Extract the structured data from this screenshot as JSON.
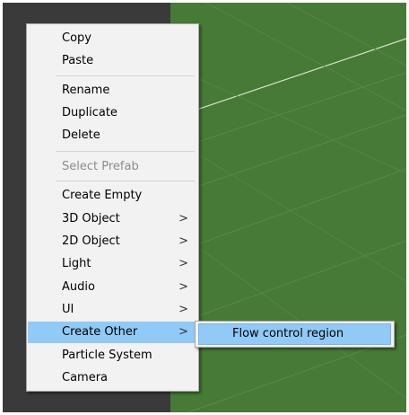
{
  "context_menu": {
    "items": [
      {
        "label": "Copy"
      },
      {
        "label": "Paste"
      },
      {
        "label": "Rename"
      },
      {
        "label": "Duplicate"
      },
      {
        "label": "Delete"
      },
      {
        "label": "Select Prefab",
        "disabled": true
      },
      {
        "label": "Create Empty"
      },
      {
        "label": "3D Object",
        "arrow": ">"
      },
      {
        "label": "2D Object",
        "arrow": ">"
      },
      {
        "label": "Light",
        "arrow": ">"
      },
      {
        "label": "Audio",
        "arrow": ">"
      },
      {
        "label": "UI",
        "arrow": ">"
      },
      {
        "label": "Create Other",
        "arrow": ">",
        "highlighted": true
      },
      {
        "label": "Particle System"
      },
      {
        "label": "Camera"
      }
    ]
  },
  "submenu": {
    "items": [
      {
        "label": "Flow control region",
        "highlighted": true
      }
    ]
  },
  "colors": {
    "menu_background": "#f2f2f2",
    "highlight": "#91c9f7",
    "scene_green": "#477a36",
    "panel_dark": "#3a3a3a",
    "disabled_text": "#8c8c8c"
  },
  "icons": {
    "submenu_arrow": "chevron-right-icon"
  }
}
